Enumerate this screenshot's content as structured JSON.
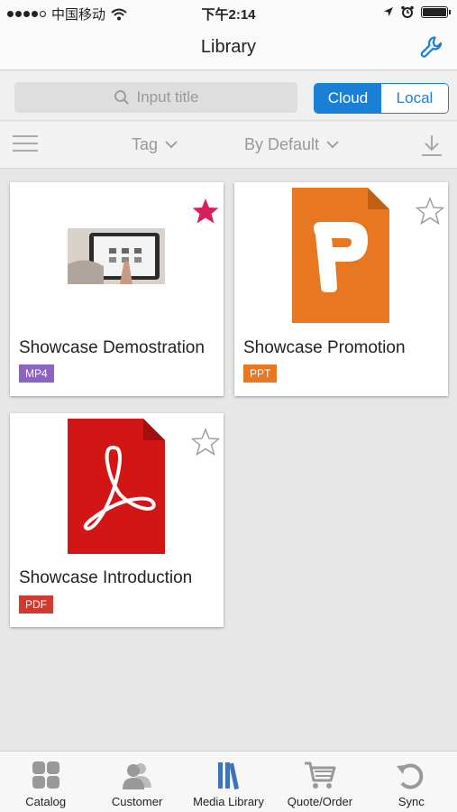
{
  "status_bar": {
    "carrier": "中国移动",
    "time": "下午2:14"
  },
  "nav": {
    "title": "Library",
    "settings_icon": "wrench-icon"
  },
  "search": {
    "placeholder": "Input title",
    "segments": [
      {
        "label": "Cloud",
        "active": true
      },
      {
        "label": "Local",
        "active": false
      }
    ]
  },
  "filters": {
    "tag_label": "Tag",
    "sort_label": "By Default"
  },
  "items": [
    {
      "title": "Showcase Demostration",
      "type": "MP4",
      "type_color": "#8a63c4",
      "favorite": true,
      "thumbnail": "video-thumbnail"
    },
    {
      "title": "Showcase Promotion",
      "type": "PPT",
      "type_color": "#e87722",
      "favorite": false,
      "thumbnail": "ppt-file-icon"
    },
    {
      "title": "Showcase Introduction",
      "type": "PDF",
      "type_color": "#d0392f",
      "favorite": false,
      "thumbnail": "pdf-file-icon"
    }
  ],
  "tabs": [
    {
      "label": "Catalog",
      "icon": "catalog-icon",
      "active": false
    },
    {
      "label": "Customer",
      "icon": "customer-icon",
      "active": false
    },
    {
      "label": "Media Library",
      "icon": "media-library-icon",
      "active": true
    },
    {
      "label": "Quote/Order",
      "icon": "cart-icon",
      "active": false
    },
    {
      "label": "Sync",
      "icon": "sync-icon",
      "active": false
    }
  ],
  "colors": {
    "accent": "#1a7fd6",
    "favorite_star": "#d81e5b",
    "inactive_icon": "#999999"
  }
}
